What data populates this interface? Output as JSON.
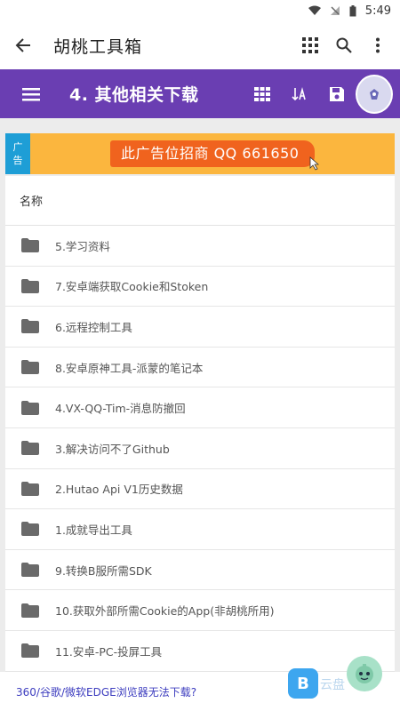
{
  "status_bar": {
    "time": "5:49"
  },
  "app_bar": {
    "title": "胡桃工具箱",
    "icons": [
      "back-arrow-icon",
      "grid-icon",
      "search-icon",
      "more-vert-icon"
    ]
  },
  "site_bar": {
    "title": "4. 其他相关下载",
    "icons": [
      "menu-icon",
      "grid-view-icon",
      "sort-icon",
      "save-icon",
      "site-logo-icon"
    ]
  },
  "ad": {
    "tag_top": "广",
    "tag_bottom": "告",
    "text": "此广告位招商 QQ 661650"
  },
  "list": {
    "header": "名称",
    "items": [
      "5.学习资料",
      "7.安卓端获取Cookie和Stoken",
      "6.远程控制工具",
      "8.安卓原神工具-派蒙的笔记本",
      "4.VX-QQ-Tim-消息防撤回",
      "3.解决访问不了Github",
      "2.Hutao Api V1历史数据",
      "1.成就导出工具",
      "9.转换B服所需SDK",
      "10.获取外部所需Cookie的App(非胡桃所用)",
      "11.安卓-PC-投屏工具"
    ]
  },
  "footer": {
    "link_text": "360/谷歌/微软EDGE浏览器无法下载?"
  },
  "float_badge": {
    "label": "B",
    "text": "云盘"
  },
  "colors": {
    "site_bar": "#6a3eb2",
    "ad_bg": "#fbb63e",
    "ad_text_bg": "#f0631e",
    "ad_tag": "#1e9ed6",
    "link": "#3d3dbf"
  }
}
